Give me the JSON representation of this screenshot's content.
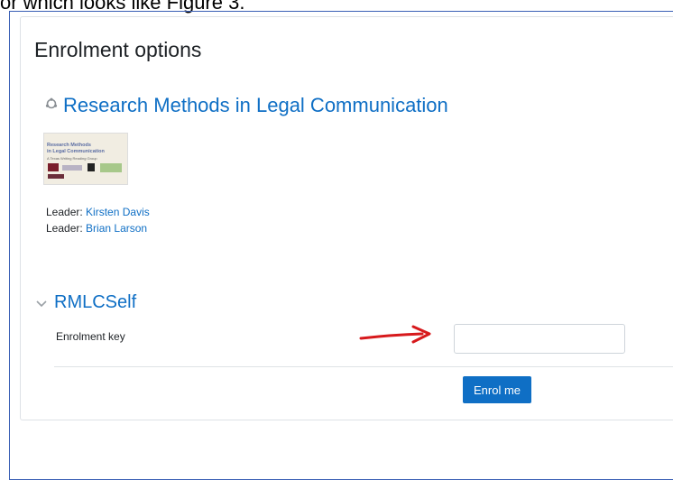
{
  "doc_caption": "or which looks like Figure 3.",
  "page": {
    "title": "Enrolment options"
  },
  "course": {
    "icon": "course-icon",
    "name": "Research Methods in Legal Communication",
    "thumbnail": {
      "title_line1": "Research Methods",
      "title_line2": "in Legal Communication",
      "subtitle": "A Texas Writing Reading Group"
    }
  },
  "leaders": [
    {
      "label": "Leader:",
      "name": "Kirsten Davis"
    },
    {
      "label": "Leader:",
      "name": "Brian Larson"
    }
  ],
  "enrolment": {
    "section_title": "RMLCSelf",
    "key_label": "Enrolment key",
    "key_value": "",
    "submit_label": "Enrol me"
  },
  "colors": {
    "link": "#0f6fc5",
    "button": "#0f6fc5",
    "annotation_arrow": "#d7191c",
    "frame_border": "#3a5fb5"
  }
}
